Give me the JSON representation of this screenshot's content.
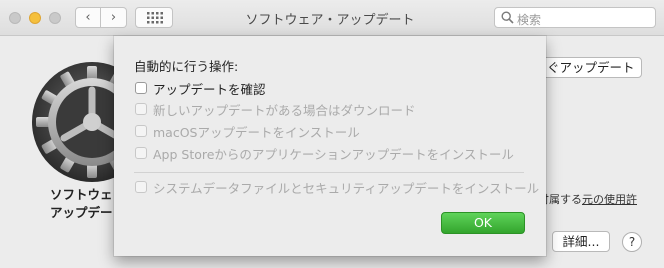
{
  "window": {
    "title": "ソフトウェア・アップデート",
    "search_placeholder": "検索",
    "back_glyph": "‹",
    "forward_glyph": "›"
  },
  "background": {
    "label_line1": "ソフトウェ",
    "label_line2": "アップデー",
    "update_now_label": "ぐアップデート",
    "license_prefix": "付属する",
    "license_link": "元の使用許",
    "details_label": "詳細...",
    "help_label": "?"
  },
  "sheet": {
    "title": "自動的に行う操作:",
    "options": [
      {
        "label": "アップデートを確認",
        "enabled": true,
        "checked": false
      },
      {
        "label": "新しいアップデートがある場合はダウンロード",
        "enabled": false,
        "checked": false
      },
      {
        "label": "macOSアップデートをインストール",
        "enabled": false,
        "checked": false
      },
      {
        "label": "App Storeからのアプリケーションアップデートをインストール",
        "enabled": false,
        "checked": false
      },
      {
        "label": "システムデータファイルとセキュリティアップデートをインストール",
        "enabled": false,
        "checked": false
      }
    ],
    "ok_label": "OK"
  },
  "colors": {
    "ok_button": "#3fb43a",
    "minimize_light": "#f5c03d"
  },
  "icons": [
    "search-icon",
    "grid-icon",
    "gear-icon",
    "chevron-left-icon",
    "chevron-right-icon"
  ]
}
